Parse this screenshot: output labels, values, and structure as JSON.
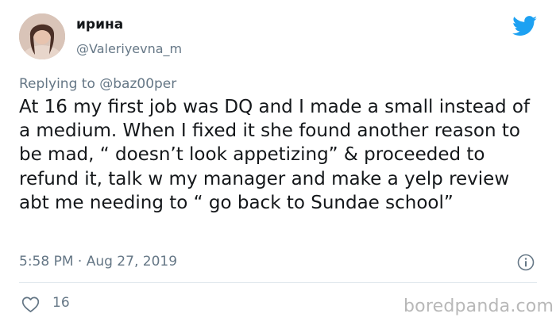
{
  "author": {
    "display_name": "ирина",
    "handle": "@Valeriyevna_m",
    "avatar_icon": "profile-photo"
  },
  "brand": {
    "icon": "twitter-bird-icon",
    "color": "#1da1f2"
  },
  "reply": {
    "prefix": "Replying to",
    "mention": "@baz00per"
  },
  "tweet": {
    "text": "At 16 my first job was DQ and I made a small instead of a medium. When I fixed it she found another reason to be mad, “ doesn’t look appetizing” & proceeded to refund it, talk w my manager and make a yelp review abt me needing to “ go back to Sundae school”",
    "timestamp": "5:58 PM · Aug 27, 2019"
  },
  "actions": {
    "like_icon": "heart-icon",
    "like_count": "16",
    "info_icon": "info-icon"
  },
  "watermark": {
    "text": "boredpanda.com"
  },
  "colors": {
    "text_primary": "#14171a",
    "text_secondary": "#657786",
    "divider": "#e1e8ed",
    "watermark": "#b8b8b8"
  }
}
